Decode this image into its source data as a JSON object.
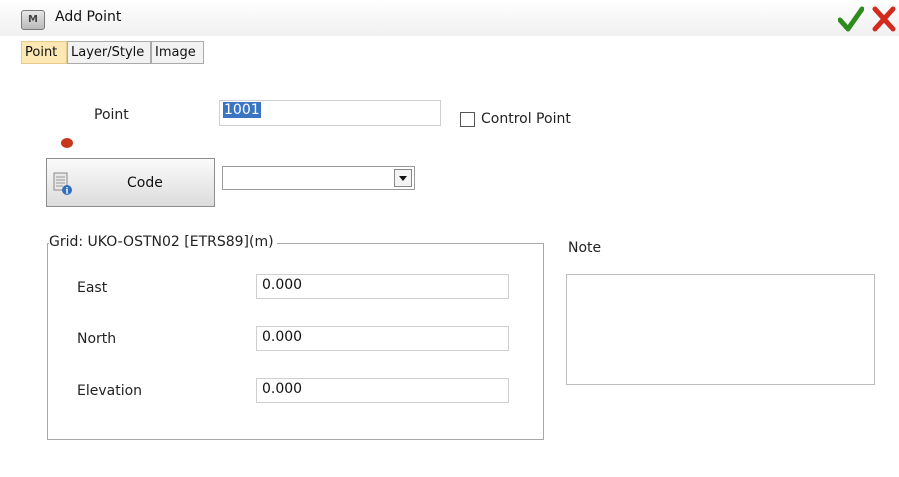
{
  "window": {
    "app_icon_text": "M",
    "title": "Add Point"
  },
  "tabs": [
    {
      "label": "Point",
      "active": true
    },
    {
      "label": "Layer/Style",
      "active": false
    },
    {
      "label": "Image",
      "active": false
    }
  ],
  "point": {
    "label": "Point",
    "value": "1001",
    "dot_color": "#c8361c",
    "control_point_label": "Control Point",
    "control_point_checked": false
  },
  "code": {
    "button_label": "Code",
    "selected_value": ""
  },
  "grid": {
    "legend": "Grid: UKO-OSTN02 [ETRS89](m)",
    "fields": [
      {
        "label": "East",
        "value": "0.000"
      },
      {
        "label": "North",
        "value": "0.000"
      },
      {
        "label": "Elevation",
        "value": "0.000"
      }
    ]
  },
  "note": {
    "label": "Note",
    "value": ""
  },
  "actions": {
    "ok_icon": "check-icon",
    "ok_color": "#2e8b1e",
    "cancel_icon": "close-icon",
    "cancel_color": "#d42a1e"
  }
}
